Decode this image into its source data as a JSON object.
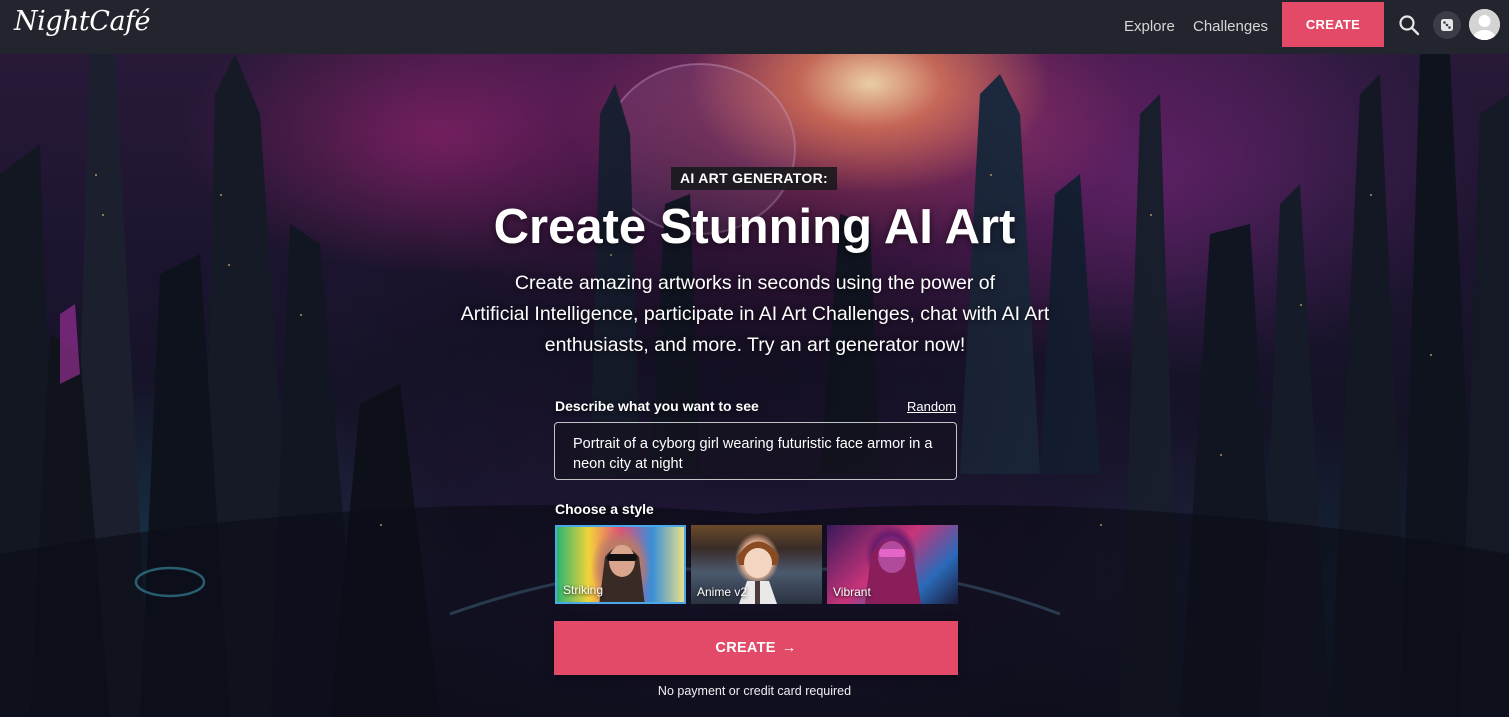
{
  "nav": {
    "logo": "NightCafé",
    "links": [
      {
        "label": "Explore"
      },
      {
        "label": "Challenges"
      }
    ],
    "create_label": "CREATE",
    "icons": {
      "search": "search-icon",
      "random": "dice-icon",
      "account": "avatar-icon"
    }
  },
  "hero": {
    "badge": "AI ART GENERATOR:",
    "title": "Create Stunning AI Art",
    "subtitle_lines": [
      "Create amazing artworks in seconds using the power of",
      "Artificial Intelligence, participate in AI Art Challenges, chat with AI Art",
      "enthusiasts, and more. Try an art generator now!"
    ]
  },
  "form": {
    "prompt_label": "Describe what you want to see",
    "random_label": "Random",
    "prompt_value": "Portrait of a cyborg girl wearing futuristic face armor in a neon city at night",
    "style_label": "Choose a style",
    "styles": [
      {
        "label": "Striking",
        "selected": true
      },
      {
        "label": "Anime v2",
        "selected": false
      },
      {
        "label": "Vibrant",
        "selected": false
      }
    ],
    "create_label": "CREATE",
    "create_arrow": "→",
    "footnote": "No payment or credit card required"
  },
  "colors": {
    "accent": "#e34a68",
    "navbar": "#22252d",
    "selected_border": "#4aa8e8"
  }
}
